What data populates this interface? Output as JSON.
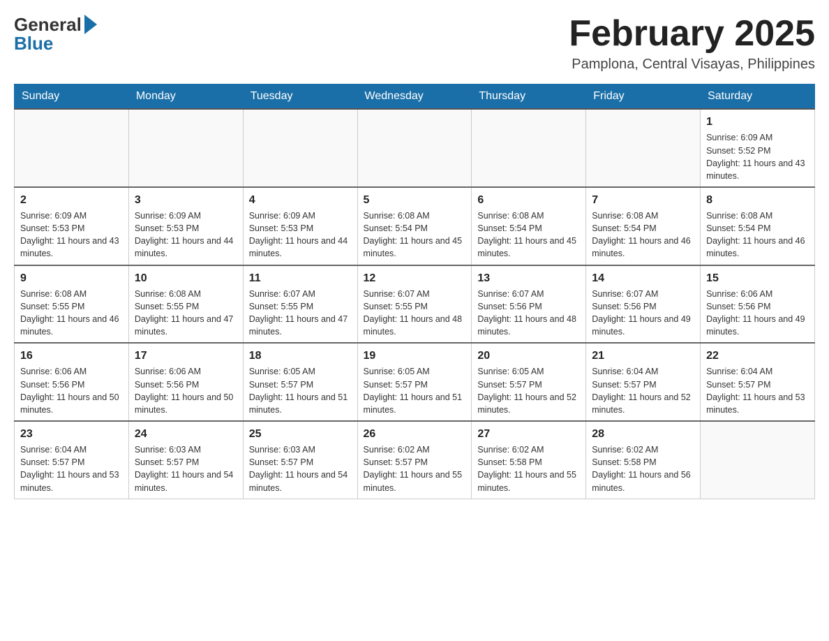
{
  "header": {
    "logo_general": "General",
    "logo_blue": "Blue",
    "month_title": "February 2025",
    "location": "Pamplona, Central Visayas, Philippines"
  },
  "days_of_week": [
    "Sunday",
    "Monday",
    "Tuesday",
    "Wednesday",
    "Thursday",
    "Friday",
    "Saturday"
  ],
  "weeks": [
    [
      {
        "day": "",
        "sunrise": "",
        "sunset": "",
        "daylight": ""
      },
      {
        "day": "",
        "sunrise": "",
        "sunset": "",
        "daylight": ""
      },
      {
        "day": "",
        "sunrise": "",
        "sunset": "",
        "daylight": ""
      },
      {
        "day": "",
        "sunrise": "",
        "sunset": "",
        "daylight": ""
      },
      {
        "day": "",
        "sunrise": "",
        "sunset": "",
        "daylight": ""
      },
      {
        "day": "",
        "sunrise": "",
        "sunset": "",
        "daylight": ""
      },
      {
        "day": "1",
        "sunrise": "Sunrise: 6:09 AM",
        "sunset": "Sunset: 5:52 PM",
        "daylight": "Daylight: 11 hours and 43 minutes."
      }
    ],
    [
      {
        "day": "2",
        "sunrise": "Sunrise: 6:09 AM",
        "sunset": "Sunset: 5:53 PM",
        "daylight": "Daylight: 11 hours and 43 minutes."
      },
      {
        "day": "3",
        "sunrise": "Sunrise: 6:09 AM",
        "sunset": "Sunset: 5:53 PM",
        "daylight": "Daylight: 11 hours and 44 minutes."
      },
      {
        "day": "4",
        "sunrise": "Sunrise: 6:09 AM",
        "sunset": "Sunset: 5:53 PM",
        "daylight": "Daylight: 11 hours and 44 minutes."
      },
      {
        "day": "5",
        "sunrise": "Sunrise: 6:08 AM",
        "sunset": "Sunset: 5:54 PM",
        "daylight": "Daylight: 11 hours and 45 minutes."
      },
      {
        "day": "6",
        "sunrise": "Sunrise: 6:08 AM",
        "sunset": "Sunset: 5:54 PM",
        "daylight": "Daylight: 11 hours and 45 minutes."
      },
      {
        "day": "7",
        "sunrise": "Sunrise: 6:08 AM",
        "sunset": "Sunset: 5:54 PM",
        "daylight": "Daylight: 11 hours and 46 minutes."
      },
      {
        "day": "8",
        "sunrise": "Sunrise: 6:08 AM",
        "sunset": "Sunset: 5:54 PM",
        "daylight": "Daylight: 11 hours and 46 minutes."
      }
    ],
    [
      {
        "day": "9",
        "sunrise": "Sunrise: 6:08 AM",
        "sunset": "Sunset: 5:55 PM",
        "daylight": "Daylight: 11 hours and 46 minutes."
      },
      {
        "day": "10",
        "sunrise": "Sunrise: 6:08 AM",
        "sunset": "Sunset: 5:55 PM",
        "daylight": "Daylight: 11 hours and 47 minutes."
      },
      {
        "day": "11",
        "sunrise": "Sunrise: 6:07 AM",
        "sunset": "Sunset: 5:55 PM",
        "daylight": "Daylight: 11 hours and 47 minutes."
      },
      {
        "day": "12",
        "sunrise": "Sunrise: 6:07 AM",
        "sunset": "Sunset: 5:55 PM",
        "daylight": "Daylight: 11 hours and 48 minutes."
      },
      {
        "day": "13",
        "sunrise": "Sunrise: 6:07 AM",
        "sunset": "Sunset: 5:56 PM",
        "daylight": "Daylight: 11 hours and 48 minutes."
      },
      {
        "day": "14",
        "sunrise": "Sunrise: 6:07 AM",
        "sunset": "Sunset: 5:56 PM",
        "daylight": "Daylight: 11 hours and 49 minutes."
      },
      {
        "day": "15",
        "sunrise": "Sunrise: 6:06 AM",
        "sunset": "Sunset: 5:56 PM",
        "daylight": "Daylight: 11 hours and 49 minutes."
      }
    ],
    [
      {
        "day": "16",
        "sunrise": "Sunrise: 6:06 AM",
        "sunset": "Sunset: 5:56 PM",
        "daylight": "Daylight: 11 hours and 50 minutes."
      },
      {
        "day": "17",
        "sunrise": "Sunrise: 6:06 AM",
        "sunset": "Sunset: 5:56 PM",
        "daylight": "Daylight: 11 hours and 50 minutes."
      },
      {
        "day": "18",
        "sunrise": "Sunrise: 6:05 AM",
        "sunset": "Sunset: 5:57 PM",
        "daylight": "Daylight: 11 hours and 51 minutes."
      },
      {
        "day": "19",
        "sunrise": "Sunrise: 6:05 AM",
        "sunset": "Sunset: 5:57 PM",
        "daylight": "Daylight: 11 hours and 51 minutes."
      },
      {
        "day": "20",
        "sunrise": "Sunrise: 6:05 AM",
        "sunset": "Sunset: 5:57 PM",
        "daylight": "Daylight: 11 hours and 52 minutes."
      },
      {
        "day": "21",
        "sunrise": "Sunrise: 6:04 AM",
        "sunset": "Sunset: 5:57 PM",
        "daylight": "Daylight: 11 hours and 52 minutes."
      },
      {
        "day": "22",
        "sunrise": "Sunrise: 6:04 AM",
        "sunset": "Sunset: 5:57 PM",
        "daylight": "Daylight: 11 hours and 53 minutes."
      }
    ],
    [
      {
        "day": "23",
        "sunrise": "Sunrise: 6:04 AM",
        "sunset": "Sunset: 5:57 PM",
        "daylight": "Daylight: 11 hours and 53 minutes."
      },
      {
        "day": "24",
        "sunrise": "Sunrise: 6:03 AM",
        "sunset": "Sunset: 5:57 PM",
        "daylight": "Daylight: 11 hours and 54 minutes."
      },
      {
        "day": "25",
        "sunrise": "Sunrise: 6:03 AM",
        "sunset": "Sunset: 5:57 PM",
        "daylight": "Daylight: 11 hours and 54 minutes."
      },
      {
        "day": "26",
        "sunrise": "Sunrise: 6:02 AM",
        "sunset": "Sunset: 5:57 PM",
        "daylight": "Daylight: 11 hours and 55 minutes."
      },
      {
        "day": "27",
        "sunrise": "Sunrise: 6:02 AM",
        "sunset": "Sunset: 5:58 PM",
        "daylight": "Daylight: 11 hours and 55 minutes."
      },
      {
        "day": "28",
        "sunrise": "Sunrise: 6:02 AM",
        "sunset": "Sunset: 5:58 PM",
        "daylight": "Daylight: 11 hours and 56 minutes."
      },
      {
        "day": "",
        "sunrise": "",
        "sunset": "",
        "daylight": ""
      }
    ]
  ]
}
